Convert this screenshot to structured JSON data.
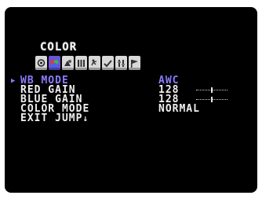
{
  "osd": {
    "title": "COLOR",
    "icons": [
      {
        "name": "camera-icon",
        "active": false
      },
      {
        "name": "color-icon",
        "active": true
      },
      {
        "name": "exposure-icon",
        "active": false
      },
      {
        "name": "pattern-icon",
        "active": false
      },
      {
        "name": "motion-icon",
        "active": false
      },
      {
        "name": "check-icon",
        "active": false
      },
      {
        "name": "adjust-icon",
        "active": false
      },
      {
        "name": "flag-icon",
        "active": false
      }
    ],
    "menu": [
      {
        "label": "WB MODE",
        "value": "AWC",
        "selected": true,
        "bar": false
      },
      {
        "label": "RED GAIN",
        "value": "128",
        "selected": false,
        "bar": true,
        "bar_level": 0.5
      },
      {
        "label": "BLUE GAIN",
        "value": "128",
        "selected": false,
        "bar": true,
        "bar_level": 0.5
      },
      {
        "label": "COLOR MODE",
        "value": "NORMAL",
        "selected": false,
        "bar": false
      },
      {
        "label": "EXIT JUMP",
        "value": "",
        "selected": false,
        "bar": false
      }
    ],
    "exit_arrow": "↓",
    "cursor_glyph": "▶"
  },
  "colors": {
    "screen_background": "#000000",
    "text": "#f0f0f0",
    "highlight": "#8a7bff",
    "icon_active": "#6a55d6",
    "icon_inactive": "#d8d8d8"
  }
}
